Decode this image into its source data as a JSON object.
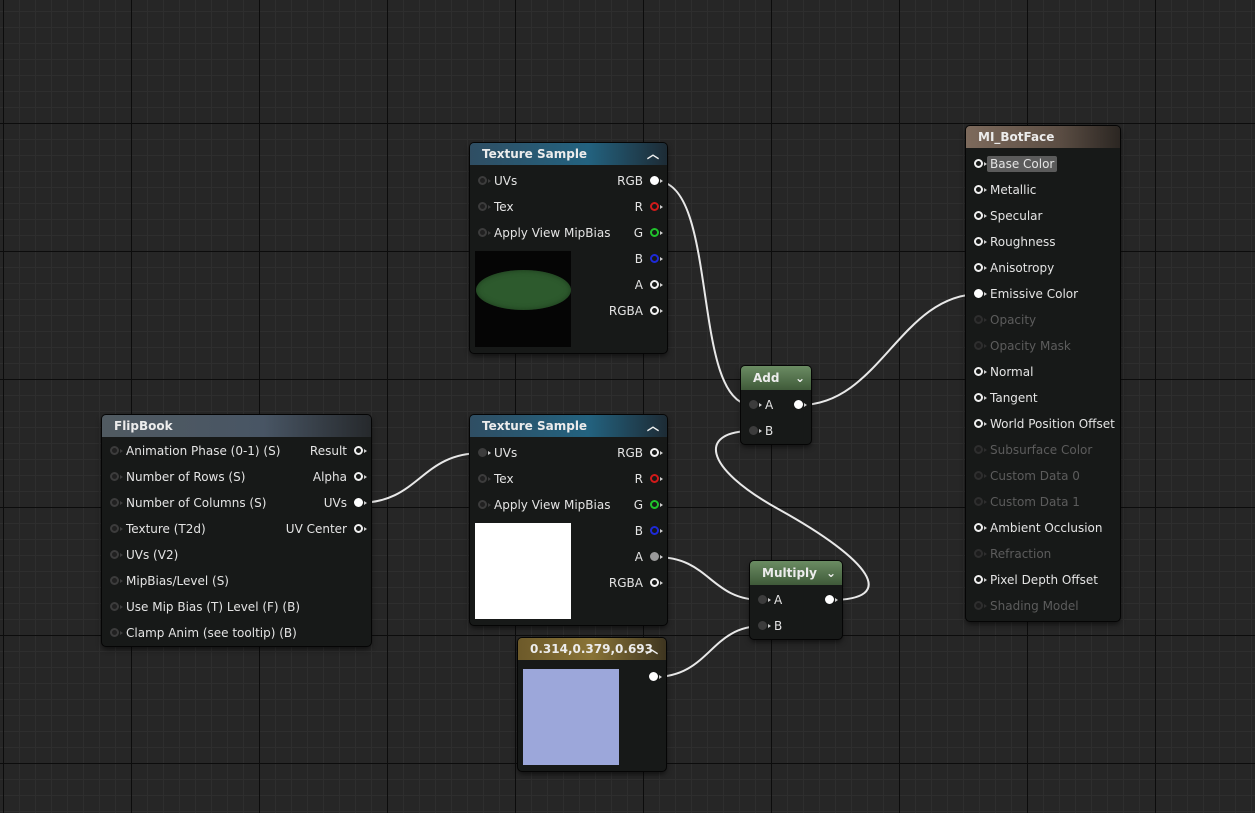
{
  "colors": {
    "rgb_pin": "#f0f0f0",
    "r_pin": "#d11a1a",
    "g_pin": "#20c22c",
    "b_pin": "#1e2ad8",
    "constant_swatch": "#9ca7da",
    "preview_white": "#ffffff",
    "preview_dark": "#050505",
    "preview_green": "#2d5a2d"
  },
  "tex1": {
    "title": "Texture Sample",
    "inputs": [
      "UVs",
      "Tex",
      "Apply View MipBias"
    ],
    "outputs": [
      "RGB",
      "R",
      "G",
      "B",
      "A",
      "RGBA"
    ]
  },
  "tex2": {
    "title": "Texture Sample",
    "inputs": [
      "UVs",
      "Tex",
      "Apply View MipBias"
    ],
    "outputs": [
      "RGB",
      "R",
      "G",
      "B",
      "A",
      "RGBA"
    ]
  },
  "flipbook": {
    "title": "FlipBook",
    "inputs": [
      "Animation  Phase (0-1) (S)",
      "Number of Rows (S)",
      "Number of Columns (S)",
      "Texture (T2d)",
      "UVs (V2)",
      "MipBias/Level (S)",
      "Use Mip Bias (T) Level (F) (B)",
      "Clamp Anim (see tooltip) (B)"
    ],
    "outputs": [
      "Result",
      "Alpha",
      "UVs",
      "UV Center"
    ]
  },
  "add": {
    "title": "Add",
    "inputs": [
      "A",
      "B"
    ]
  },
  "multiply": {
    "title": "Multiply",
    "inputs": [
      "A",
      "B"
    ]
  },
  "constant": {
    "title": "0.314,0.379,0.693"
  },
  "material": {
    "title": "MI_BotFace",
    "pins": [
      "Base Color",
      "Metallic",
      "Specular",
      "Roughness",
      "Anisotropy",
      "Emissive Color",
      "Opacity",
      "Opacity Mask",
      "Normal",
      "Tangent",
      "World Position Offset",
      "Subsurface Color",
      "Custom Data 0",
      "Custom Data 1",
      "Ambient Occlusion",
      "Refraction",
      "Pixel Depth Offset",
      "Shading Model"
    ]
  }
}
